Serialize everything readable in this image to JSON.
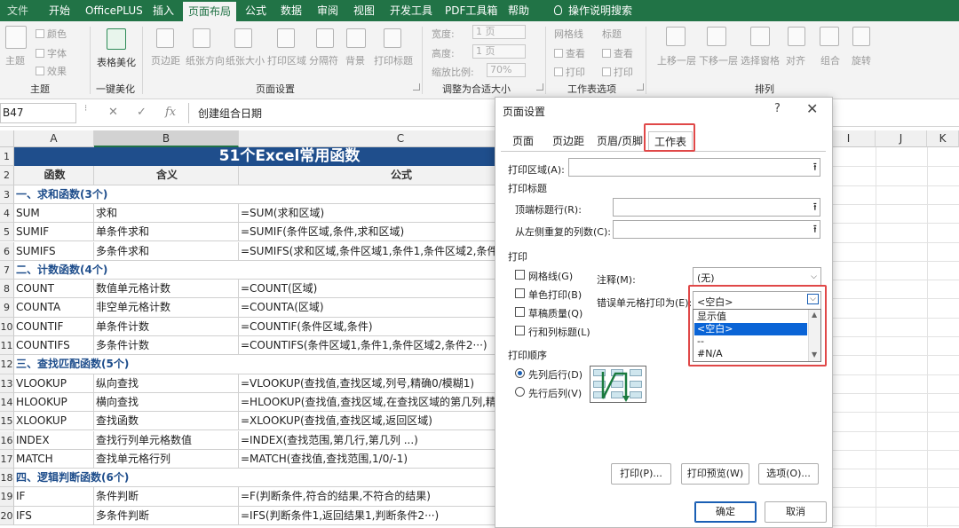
{
  "ribbon_tabs": [
    {
      "label": "文件",
      "state": "dim"
    },
    {
      "label": "开始"
    },
    {
      "label": "OfficePLUS"
    },
    {
      "label": "插入"
    },
    {
      "label": "页面布局",
      "state": "active"
    },
    {
      "label": "公式"
    },
    {
      "label": "数据"
    },
    {
      "label": "审阅"
    },
    {
      "label": "视图"
    },
    {
      "label": "开发工具"
    },
    {
      "label": "PDF工具箱"
    },
    {
      "label": "帮助"
    },
    {
      "label": "操作说明搜索"
    }
  ],
  "ribbon": {
    "theme": {
      "themes": "主题",
      "colors": "颜色",
      "fonts": "字体",
      "effects": "效果",
      "group": "主题"
    },
    "beautify": {
      "button": "表格美化",
      "group": "一键美化"
    },
    "page_setup": {
      "margins": "页边距",
      "orientation": "纸张方向",
      "size": "纸张大小",
      "print_area": "打印区域",
      "breaks": "分隔符",
      "background": "背景",
      "print_titles": "打印标题",
      "group": "页面设置"
    },
    "scale": {
      "width_label": "宽度:",
      "width_value": "1 页",
      "height_label": "高度:",
      "height_value": "1 页",
      "scale_label": "缩放比例:",
      "scale_value": "70%",
      "group": "调整为合适大小"
    },
    "sheet_options": {
      "gridlines": "网格线",
      "headings": "标题",
      "view_a": "查看",
      "view_b": "查看",
      "print_a": "打印",
      "print_b": "打印",
      "group": "工作表选项"
    },
    "arrange": {
      "bring_forward": "上移一层",
      "send_backward": "下移一层",
      "selection_pane": "选择窗格",
      "align": "对齐",
      "group_objects": "组合",
      "rotate": "旋转",
      "group": "排列"
    }
  },
  "formula_bar": {
    "name_box": "B47",
    "cancel": "✕",
    "enter": "✓",
    "fx": "fx",
    "content": "创建组合日期"
  },
  "columns": [
    "A",
    "B",
    "C",
    "",
    "",
    "",
    "",
    "",
    "I",
    "J",
    "K"
  ],
  "rows": [
    "1",
    "2",
    "3",
    "4",
    "5",
    "6",
    "7",
    "8",
    "9",
    "10",
    "11",
    "12",
    "13",
    "14",
    "15",
    "16",
    "17",
    "18",
    "19",
    "20"
  ],
  "sheet": {
    "title": "51个Excel常用函数",
    "headers": [
      "函数",
      "含义",
      "公式"
    ],
    "body": [
      {
        "type": "section",
        "text": "一、求和函数(3个)"
      },
      {
        "a": "SUM",
        "b": "求和",
        "c": "=SUM(求和区域)"
      },
      {
        "a": "SUMIF",
        "b": "单条件求和",
        "c": "=SUMIF(条件区域,条件,求和区域)"
      },
      {
        "a": "SUMIFS",
        "b": "多条件求和",
        "c": "=SUMIFS(求和区域,条件区域1,条件1,条件区域2,条件"
      },
      {
        "type": "section",
        "text": "二、计数函数(4个)"
      },
      {
        "a": "COUNT",
        "b": "数值单元格计数",
        "c": "=COUNT(区域)"
      },
      {
        "a": "COUNTA",
        "b": "非空单元格计数",
        "c": "=COUNTA(区域)"
      },
      {
        "a": "COUNTIF",
        "b": "单条件计数",
        "c": "=COUNTIF(条件区域,条件)"
      },
      {
        "a": "COUNTIFS",
        "b": "多条件计数",
        "c": "=COUNTIFS(条件区域1,条件1,条件区域2,条件2···)"
      },
      {
        "type": "section",
        "text": "三、查找匹配函数(5个)"
      },
      {
        "a": "VLOOKUP",
        "b": "纵向查找",
        "c": "=VLOOKUP(查找值,查找区域,列号,精确0/模糊1)"
      },
      {
        "a": "HLOOKUP",
        "b": "横向查找",
        "c": "=HLOOKUP(查找值,查找区域,在查找区域的第几列,精"
      },
      {
        "a": "XLOOKUP",
        "b": "查找函数",
        "c": "=XLOOKUP(查找值,查找区域,返回区域)"
      },
      {
        "a": "INDEX",
        "b": "查找行列单元格数值",
        "c": "=INDEX(查找范围,第几行,第几列 ...)"
      },
      {
        "a": "MATCH",
        "b": "查找单元格行列",
        "c": "=MATCH(查找值,查找范围,1/0/-1)"
      },
      {
        "type": "section",
        "text": "四、逻辑判断函数(6个)"
      },
      {
        "a": "IF",
        "b": "条件判断",
        "c": "=F(判断条件,符合的结果,不符合的结果)"
      },
      {
        "a": "IFS",
        "b": "多条件判断",
        "c": "=IFS(判断条件1,返回结果1,判断条件2···)"
      }
    ]
  },
  "dialog": {
    "title": "页面设置",
    "help": "?",
    "close": "✕",
    "tabs": [
      "页面",
      "页边距",
      "页眉/页脚",
      "工作表"
    ],
    "print_area_label": "打印区域(A):",
    "print_titles_label": "打印标题",
    "rows_to_repeat_label": "顶端标题行(R):",
    "cols_to_repeat_label": "从左侧重复的列数(C):",
    "print_label": "打印",
    "gridlines": "网格线(G)",
    "black_white": "单色打印(B)",
    "draft": "草稿质量(Q)",
    "row_col_headings": "行和列标题(L)",
    "comments_label": "注释(M):",
    "comments_value": "(无)",
    "errors_label": "错误单元格打印为(E):",
    "errors_value": "<空白>",
    "errors_options": [
      "显示值",
      "<空白>",
      "--",
      "#N/A"
    ],
    "order_label": "打印顺序",
    "down_then_over": "先列后行(D)",
    "over_then_down": "先行后列(V)",
    "print_btn": "打印(P)...",
    "preview_btn": "打印预览(W)",
    "options_btn": "选项(O)...",
    "ok_btn": "确定",
    "cancel_btn": "取消"
  },
  "colors": {
    "ribbon_green": "#217346",
    "title_blue": "#1f4e8c",
    "highlight_red": "#e04848",
    "selection_blue": "#0a64d6"
  }
}
